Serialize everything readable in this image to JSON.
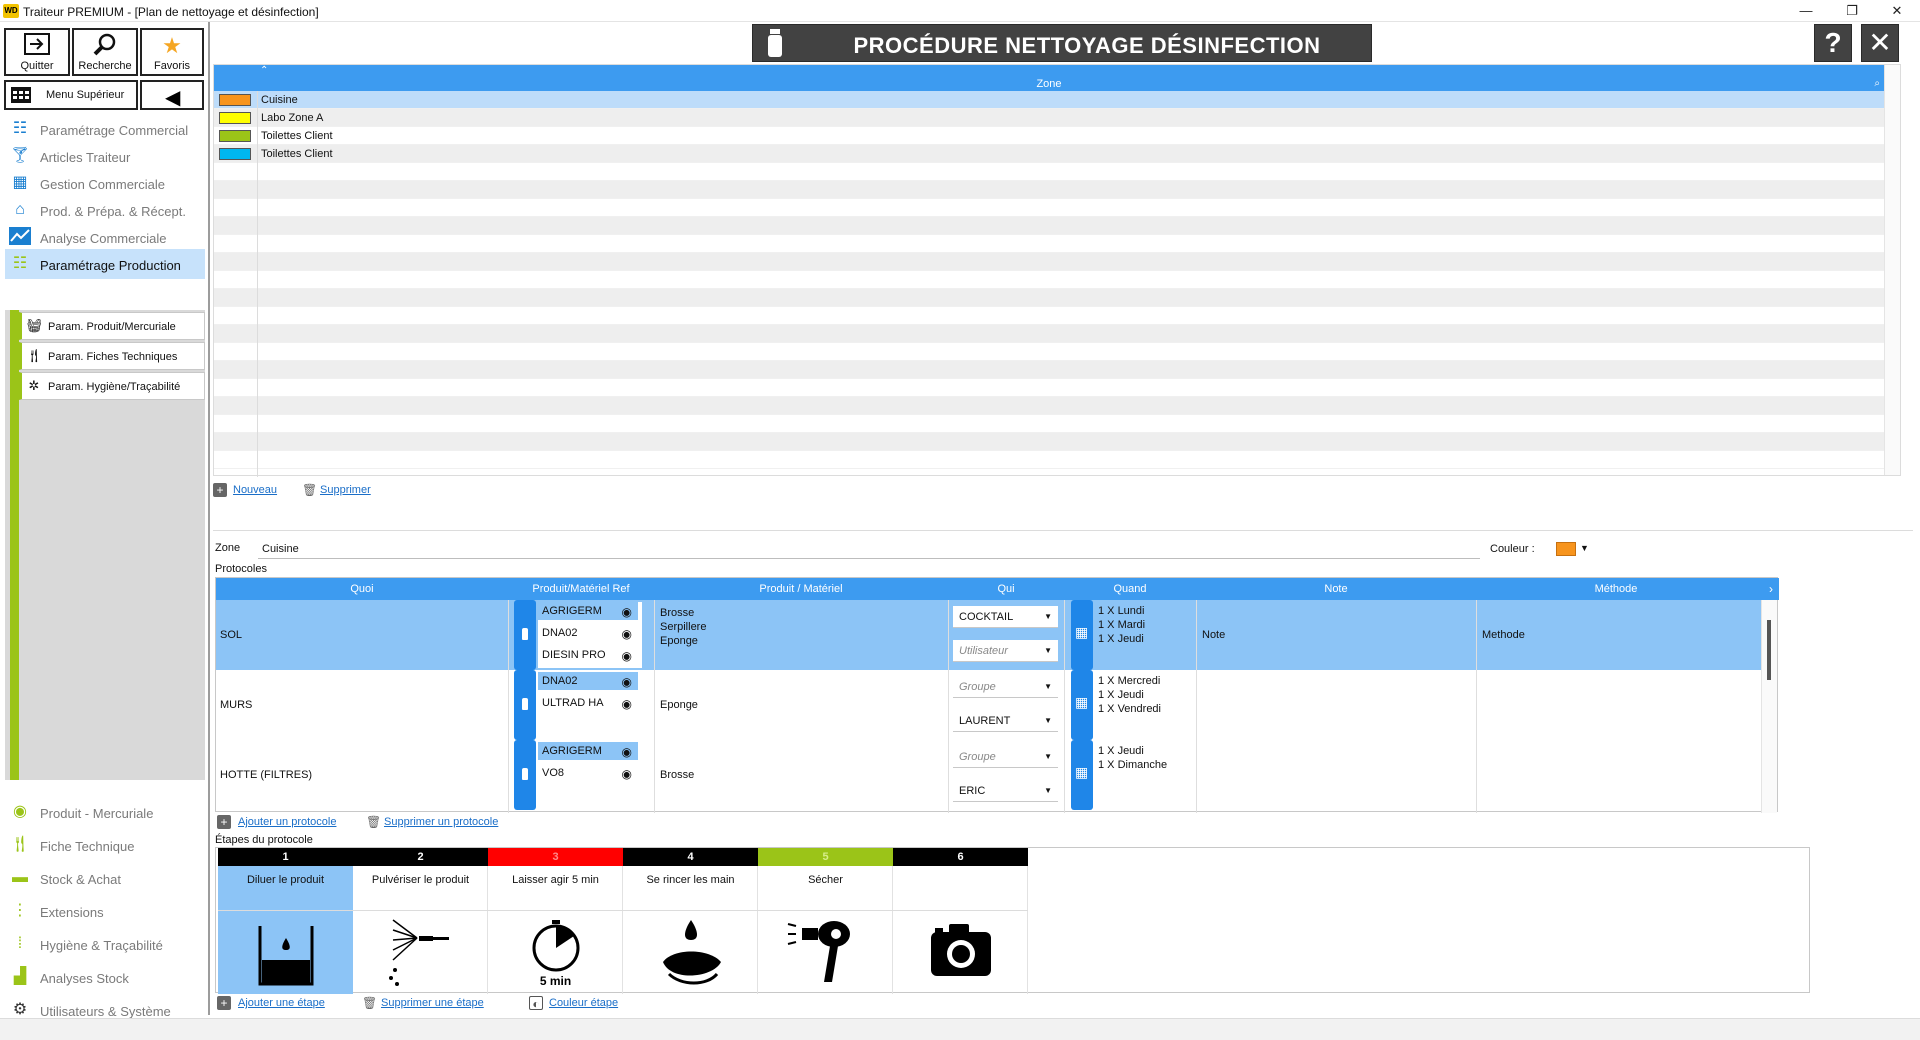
{
  "window": {
    "logo_text": "WD",
    "title": "Traiteur PREMIUM - [Plan de nettoyage et désinfection]",
    "minimize": "—",
    "restore": "❐",
    "close": "✕"
  },
  "toolbar": {
    "quit_label": "Quitter",
    "search_label": "Recherche",
    "favorites_label": "Favoris",
    "menu_label": "Menu Supérieur"
  },
  "menu": {
    "items": [
      {
        "label": "Paramétrage Commercial",
        "icon": "sliders-icon"
      },
      {
        "label": "Articles Traiteur",
        "icon": "cocktail-icon"
      },
      {
        "label": "Gestion Commerciale",
        "icon": "calculator-icon"
      },
      {
        "label": "Prod. & Prépa. & Récept.",
        "icon": "factory-icon"
      },
      {
        "label": "Analyse Commerciale",
        "icon": "chart-line-icon"
      },
      {
        "label": "Paramétrage Production",
        "icon": "sliders-icon"
      }
    ],
    "sub_items": [
      {
        "label": "Param. Produit/Mercuriale",
        "icon": "basket-icon"
      },
      {
        "label": "Param. Fiches Techniques",
        "icon": "cutlery-icon"
      },
      {
        "label": "Param. Hygiène/Traçabilité",
        "icon": "bug-icon"
      }
    ],
    "bottom_items": [
      {
        "label": "Produit - Mercuriale",
        "icon": "steak-icon"
      },
      {
        "label": "Fiche Technique",
        "icon": "cutlery-icon"
      },
      {
        "label": "Stock & Achat",
        "icon": "truck-icon"
      },
      {
        "label": "Extensions",
        "icon": "dots-icon"
      },
      {
        "label": "Hygiène & Traçabilité",
        "icon": "dots-icon"
      },
      {
        "label": "Analyses Stock",
        "icon": "bars-icon"
      },
      {
        "label": "Utilisateurs & Système",
        "icon": "gear-icon"
      }
    ]
  },
  "header": {
    "title": "PROCÉDURE NETTOYAGE DÉSINFECTION",
    "help": "?",
    "close": "✕"
  },
  "zone_table": {
    "column": "Zone",
    "rows": [
      {
        "name": "Cuisine",
        "color": "#f7941d"
      },
      {
        "name": "Labo Zone A",
        "color": "#ffff00"
      },
      {
        "name": "Toilettes Client",
        "color": "#9bc418"
      },
      {
        "name": "Toilettes Client",
        "color": "#00b7ef"
      }
    ],
    "new_label": "Nouveau",
    "delete_label": "Supprimer"
  },
  "detail": {
    "zone_label": "Zone",
    "zone_value": "Cuisine",
    "color_label": "Couleur :",
    "color_value": "#f7941d",
    "protocols_label": "Protocoles"
  },
  "protocols": {
    "columns": [
      "Quoi",
      "Produit/Matériel Ref",
      "Produit / Matériel",
      "Qui",
      "Quand",
      "Note",
      "Méthode"
    ],
    "rows": [
      {
        "quoi": "SOL",
        "refs": [
          "AGRIGERM",
          "DNA02",
          "DIESIN PRO"
        ],
        "materiel": [
          "Brosse",
          "Serpillere",
          "Eponge"
        ],
        "qui": [
          "COCKTAIL",
          "Utilisateur"
        ],
        "quand": [
          "1 X Lundi",
          "1 X Mardi",
          "1 X Jeudi"
        ],
        "note": "Note",
        "methode": "Methode"
      },
      {
        "quoi": "MURS",
        "refs": [
          "DNA02",
          "ULTRAD HA"
        ],
        "materiel": [
          "Eponge"
        ],
        "qui": [
          "Groupe",
          "LAURENT"
        ],
        "quand": [
          "1 X Mercredi",
          "1 X Jeudi",
          "1 X Vendredi"
        ],
        "note": "",
        "methode": ""
      },
      {
        "quoi": "HOTTE (FILTRES)",
        "refs": [
          "AGRIGERM",
          "VO8"
        ],
        "materiel": [
          "Brosse"
        ],
        "qui": [
          "Groupe",
          "ERIC"
        ],
        "quand": [
          "1 X Jeudi",
          "1 X Dimanche"
        ],
        "note": "",
        "methode": ""
      }
    ],
    "add_label": "Ajouter un protocole",
    "delete_label": "Supprimer un protocole"
  },
  "steps": {
    "label": "Étapes du protocole",
    "items": [
      {
        "num": "1",
        "text": "Diluer le produit",
        "color": "#000000",
        "num_color": "#ffffff",
        "icon": "dilute-icon"
      },
      {
        "num": "2",
        "text": "Pulvériser le produit",
        "color": "#000000",
        "num_color": "#ffffff",
        "icon": "spray-icon"
      },
      {
        "num": "3",
        "text": "Laisser agir 5 min",
        "color": "#ff0000",
        "num_color": "#ff8a8a",
        "icon": "timer-icon",
        "icon_caption": "5 min"
      },
      {
        "num": "4",
        "text": "Se rincer les main",
        "color": "#000000",
        "num_color": "#ffffff",
        "icon": "rinse-hands-icon"
      },
      {
        "num": "5",
        "text": "Sécher",
        "color": "#9bc418",
        "num_color": "#d6ee8a",
        "icon": "hair-dryer-icon"
      },
      {
        "num": "6",
        "text": "",
        "color": "#000000",
        "num_color": "#ffffff",
        "icon": "camera-icon"
      }
    ],
    "add_label": "Ajouter une étape",
    "delete_label": "Supprimer une étape",
    "color_label": "Couleur étape"
  }
}
